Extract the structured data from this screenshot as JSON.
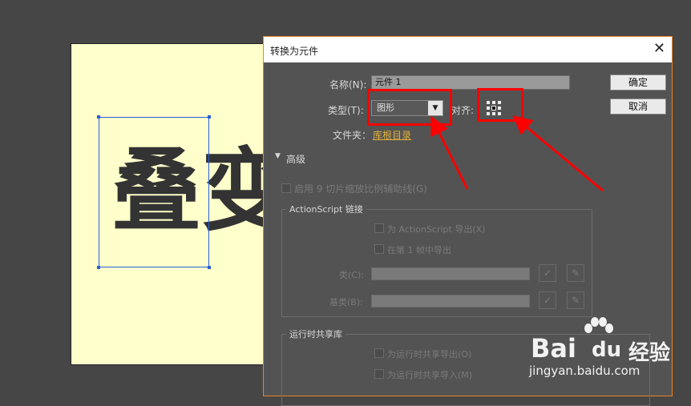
{
  "stage": {
    "chars": [
      "叠",
      "变"
    ]
  },
  "dialog": {
    "title": "转换为元件",
    "close_glyph": "✕",
    "name_label": "名称(N):",
    "name_value": "元件 1",
    "ok_label": "确定",
    "cancel_label": "取消",
    "type_label": "类型(T):",
    "type_value": "图形",
    "align_label": "对齐:",
    "folder_label": "文件夹：",
    "folder_value": "库根目录",
    "advanced_label": "高级",
    "nine_slice_label": "启用 9 切片缩放比例辅助线(G)",
    "actionscript": {
      "title": "ActionScript 链接",
      "export_as": "为 ActionScript 导出(X)",
      "export_frame1": "在第 1 帧中导出",
      "class_label": "类(C):",
      "base_class_label": "基类(B):",
      "check_glyph": "✓",
      "pencil_glyph": "✎"
    },
    "runtime": {
      "title": "运行时共享库",
      "export_share": "为运行时共享导出(O)",
      "import_share": "为运行时共享导入(M)"
    }
  },
  "watermark": {
    "brand": "Bai",
    "brand_suffix": "du",
    "product": "经验",
    "url": "jingyan.baidu.com"
  },
  "colors": {
    "highlight": "#ff0000",
    "link": "#e1b13a",
    "selection": "#2a5fd8"
  }
}
